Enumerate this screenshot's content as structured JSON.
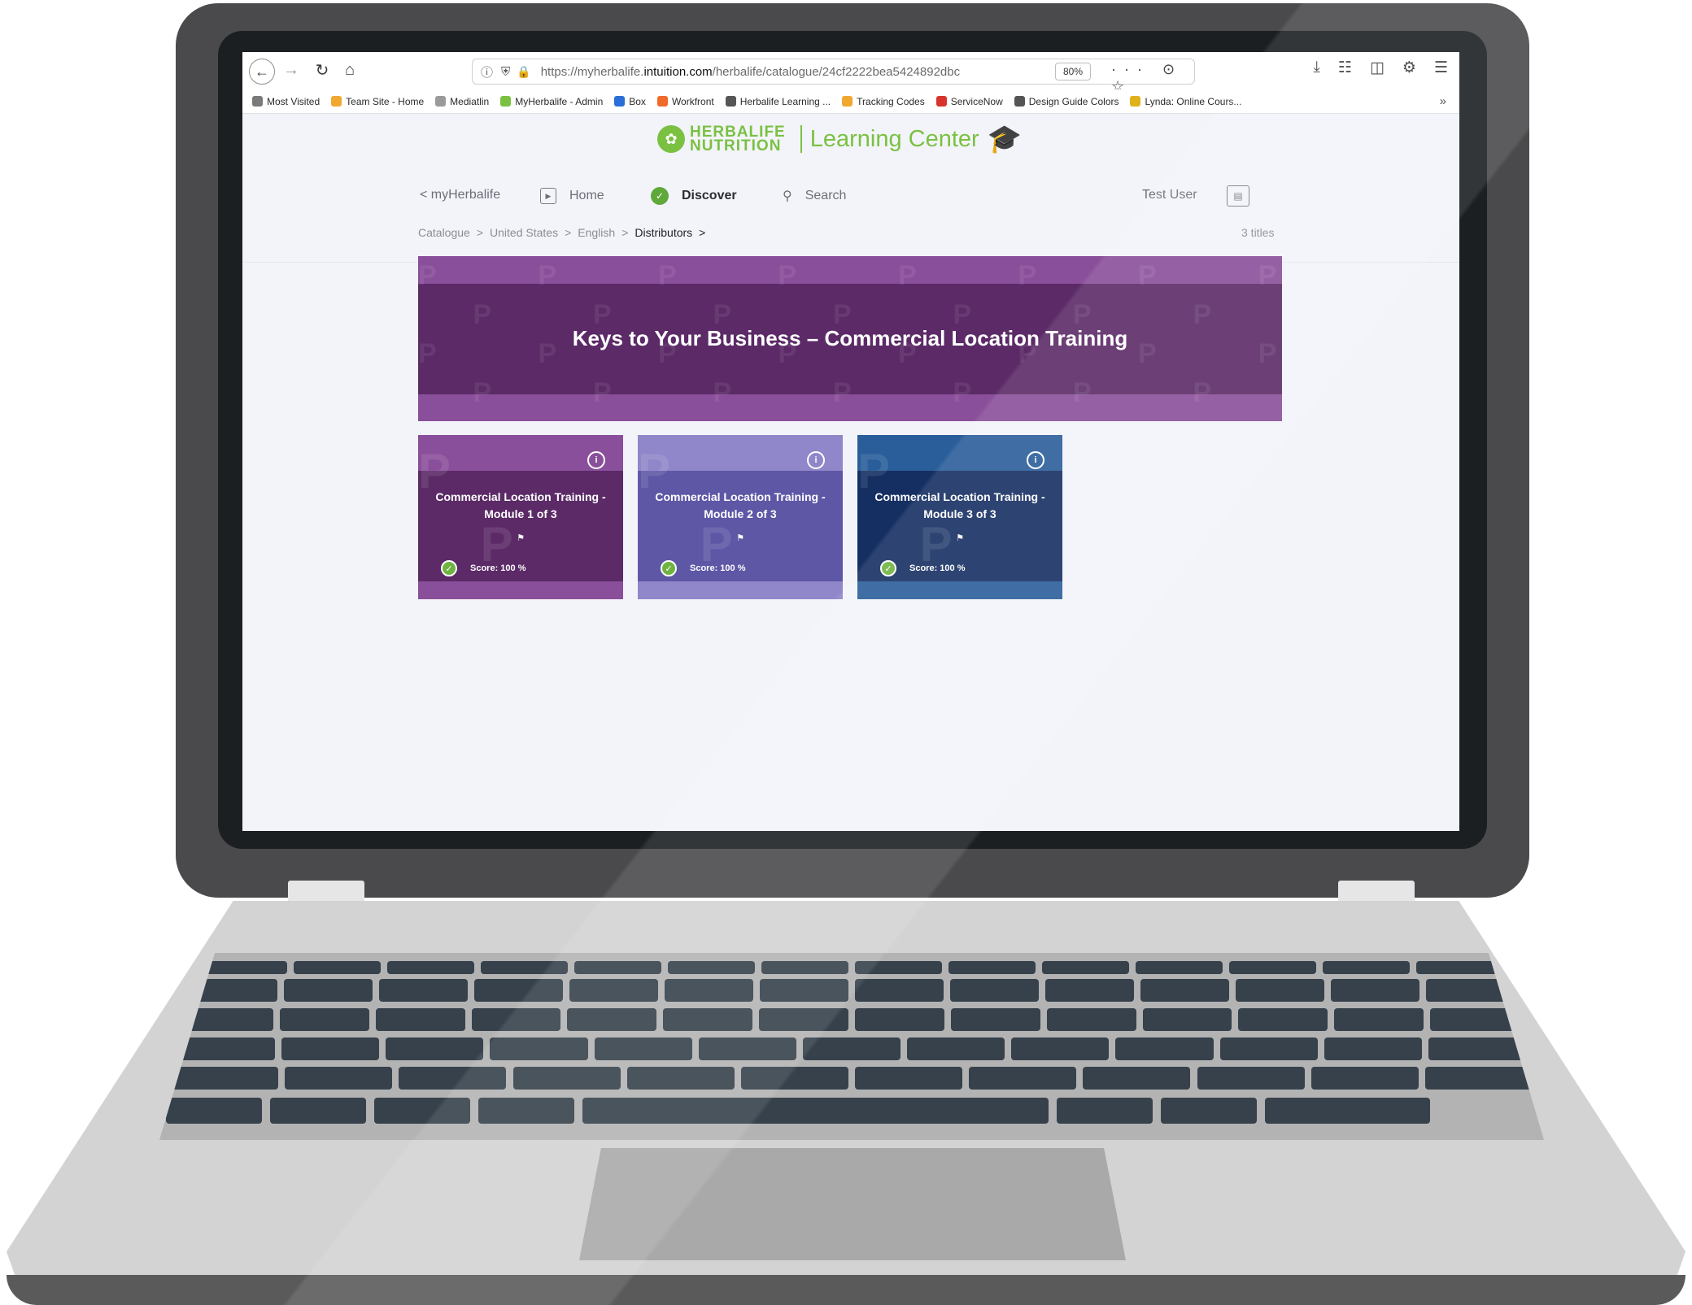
{
  "browser": {
    "nav_icons": [
      "back-icon",
      "forward-icon",
      "reload-icon",
      "home-icon"
    ],
    "url_prefix": "https://myherbalife.",
    "url_domain": "intuition.com",
    "url_path": "/herbalife/catalogue/24cf2222bea5424892dbc",
    "zoom": "80%",
    "url_actions": "··· ⊙ ☆"
  },
  "bookmarks": [
    {
      "label": "Most Visited",
      "color": "#7a7a7a"
    },
    {
      "label": "Team Site - Home",
      "color": "#f0a830"
    },
    {
      "label": "Mediatlin",
      "color": "#9a9a9a"
    },
    {
      "label": "MyHerbalife - Admin",
      "color": "#7ac142"
    },
    {
      "label": "Box",
      "color": "#2a6fd6"
    },
    {
      "label": "Workfront",
      "color": "#f06a2a"
    },
    {
      "label": "Herbalife Learning ...",
      "color": "#555555"
    },
    {
      "label": "Tracking Codes",
      "color": "#f0a830"
    },
    {
      "label": "ServiceNow",
      "color": "#d9342b"
    },
    {
      "label": "Design Guide Colors",
      "color": "#555555"
    },
    {
      "label": "Lynda: Online Cours...",
      "color": "#e0b21a"
    }
  ],
  "site": {
    "brand_line1": "HERBALIFE",
    "brand_line2": "NUTRITION",
    "product": "Learning Center",
    "accent": "#7ac142"
  },
  "nav": {
    "back_link": "< myHerbalife",
    "home": "Home",
    "discover": "Discover",
    "search": "Search",
    "user": "Test User"
  },
  "breadcrumb": {
    "items": [
      "Catalogue",
      ">",
      "United States",
      ">",
      "English",
      ">",
      "Distributors",
      ">"
    ],
    "count": "3 titles"
  },
  "banner": {
    "title": "Keys to Your Business – Commercial Location Training",
    "color_light": "#8a4f9a",
    "color_dark": "#5b2a67"
  },
  "cards": [
    {
      "title_line1": "Commercial Location Training -",
      "title_line2": "Module 1 of 3",
      "score": "Score: 100 %",
      "light": "#8a4f9a",
      "dark": "#5b2a67"
    },
    {
      "title_line1": "Commercial Location Training -",
      "title_line2": "Module 2 of 3",
      "score": "Score: 100 %",
      "light": "#8f87c9",
      "dark": "#5e57a6"
    },
    {
      "title_line1": "Commercial Location Training -",
      "title_line2": "Module 3 of 3",
      "score": "Score: 100 %",
      "light": "#2a5e9a",
      "dark": "#152f63"
    }
  ]
}
